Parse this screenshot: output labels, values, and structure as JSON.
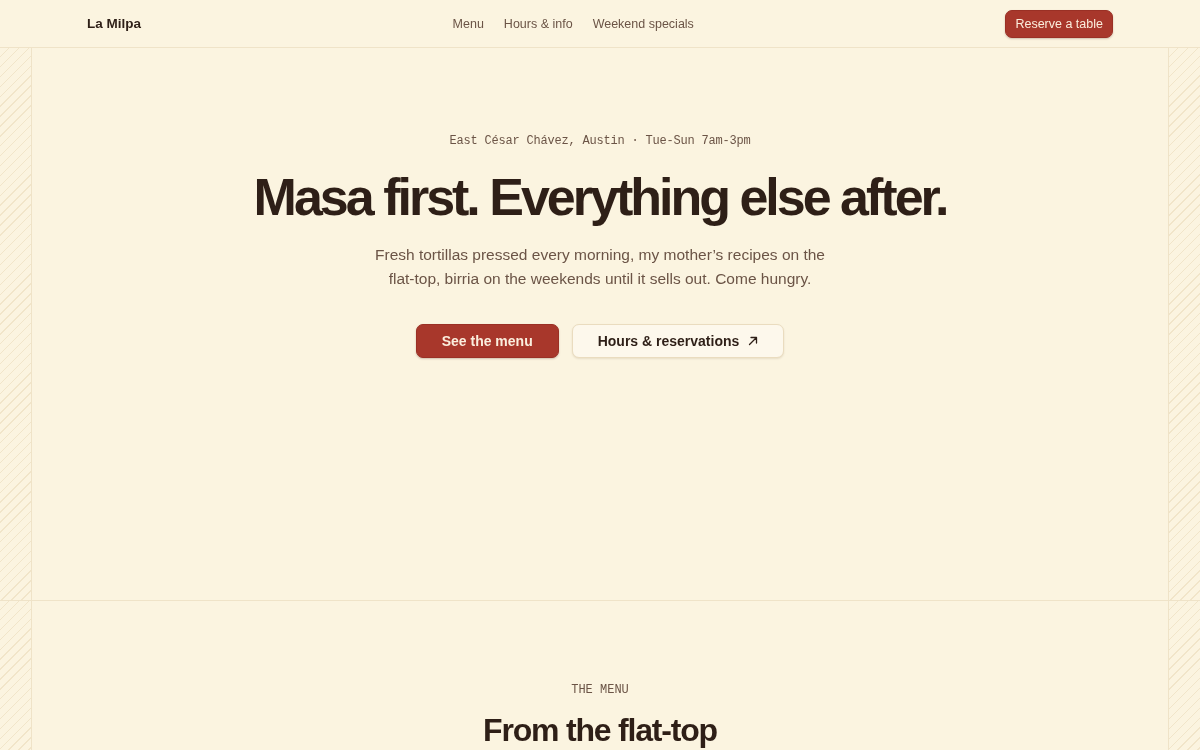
{
  "header": {
    "brand": "La Milpa",
    "nav": [
      "Menu",
      "Hours & info",
      "Weekend specials"
    ],
    "cta": "Reserve a table"
  },
  "hero": {
    "eyebrow": "East César Chávez, Austin · Tue-Sun 7am-3pm",
    "title": "Masa first. Everything else after.",
    "lead": "Fresh tortillas pressed every morning, my mother’s recipes on the flat-top, birria on the weekends until it sells out. Come hungry.",
    "actions": [
      {
        "label": "See the menu",
        "kind": "primary"
      },
      {
        "label": "Hours & reservations",
        "kind": "secondary"
      }
    ]
  },
  "menu_section": {
    "eyebrow": "THE MENU",
    "title": "From the flat-top"
  }
}
